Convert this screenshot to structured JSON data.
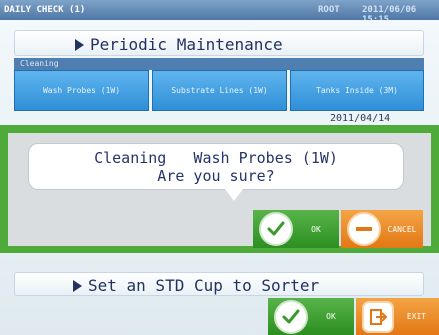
{
  "header": {
    "screen_title": "DAILY CHECK (1)",
    "user": "ROOT",
    "datetime": "2011/06/06 15:15"
  },
  "maintenance": {
    "title": "Periodic Maintenance",
    "section_label": "Cleaning",
    "items": [
      {
        "label": "Wash Probes (1W)"
      },
      {
        "label": "Substrate Lines (1W)"
      },
      {
        "label": "Tanks Inside (3M)"
      }
    ],
    "last_date": "2011/04/14"
  },
  "dialog": {
    "message_line1": "Cleaning   Wash Probes (1W)",
    "message_line2": "Are you sure?",
    "ok_label": "OK",
    "cancel_label": "CANCEL"
  },
  "bottom": {
    "instruction": "Set an STD Cup to Sorter",
    "ok_label": "OK",
    "exit_label": "EXIT"
  },
  "colors": {
    "dialog_frame": "#4eab3a",
    "ok_button": "#3fa032",
    "cancel_button": "#f08c2a",
    "category_button": "#3a9be0"
  },
  "icons": {
    "ok": "check-circle-icon",
    "cancel": "minus-circle-icon",
    "exit": "exit-door-icon"
  }
}
